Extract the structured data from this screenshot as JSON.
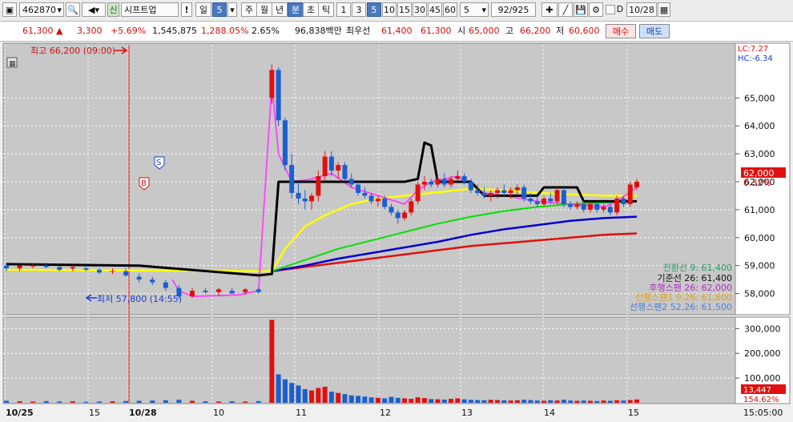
{
  "toolbar": {
    "code": "462870",
    "badge": "신",
    "name": "시프트업",
    "period_buttons": [
      "일",
      "5",
      "주",
      "월",
      "년",
      "분",
      "초",
      "틱"
    ],
    "interval_buttons": [
      "1",
      "3",
      "5",
      "10",
      "15",
      "30",
      "45",
      "60"
    ],
    "count": "5",
    "page": "92/925",
    "check_label": "D",
    "date": "10/28"
  },
  "quote": {
    "price": "61,300",
    "arrow": "▲",
    "change": "3,300",
    "change_pct": "+5.69%",
    "volume": "1,545,875",
    "volume_ratio": "1,288.05%",
    "turnover": "2.65%",
    "amount": "96,838백만",
    "best_label": "최우선",
    "best_ask": "61,400",
    "best_bid": "61,300",
    "open_label": "시",
    "open": "65,000",
    "high_label": "고",
    "high": "66,200",
    "low_label": "저",
    "low": "60,600",
    "buy": "매수",
    "sell": "매도"
  },
  "chart_data": {
    "type": "candlestick",
    "y_ticks": [
      "65,000",
      "64,000",
      "63,000",
      "62,000",
      "61,000",
      "60,000",
      "59,000",
      "58,000"
    ],
    "ylim": [
      57300,
      66900
    ],
    "volume_ticks": [
      "300,000",
      "200,000",
      "100,000"
    ],
    "volume_ylim": [
      0,
      340000
    ],
    "x_labels": [
      "10/25",
      "15",
      "10/28",
      "10",
      "11",
      "12",
      "13",
      "14",
      "15"
    ],
    "crosshair_time": "15:05:00",
    "lc": "LC:7.27",
    "hc": "HC:-6.34",
    "current_price": "62,000",
    "current_pct": "0.32%",
    "volume_current": "13,447",
    "volume_pct": "154.62%",
    "high_annotation": "최고 66,200 (09:00)",
    "low_annotation": "최저 57,800 (14:55)",
    "marker_s": "S",
    "marker_b": "B",
    "legend": [
      {
        "label": "전환선 9: 61,400",
        "color": "#2a9a6a"
      },
      {
        "label": "기준선 26: 61,400",
        "color": "#111111"
      },
      {
        "label": "후행스팬 26: 62,000",
        "color": "#b030c0"
      },
      {
        "label": "선행스팬1 9,26: 61,800",
        "color": "#e0a020"
      },
      {
        "label": "선행스팬2 52,26: 61,500",
        "color": "#4f7fd0"
      }
    ],
    "ma_colors": [
      "#ffff00",
      "#00e000",
      "#0000d0",
      "#e01010",
      "#ff40ff"
    ],
    "candles": [
      {
        "t": 0,
        "o": 59,
        "h": 59.1,
        "l": 58.8,
        "c": 58.9
      },
      {
        "t": 2,
        "o": 58.9,
        "h": 59,
        "l": 58.8,
        "c": 59
      },
      {
        "t": 4,
        "o": 59,
        "h": 59.1,
        "l": 58.9,
        "c": 59.0
      },
      {
        "t": 6,
        "o": 59,
        "h": 59.1,
        "l": 58.9,
        "c": 58.95
      },
      {
        "t": 8,
        "o": 58.95,
        "h": 59,
        "l": 58.8,
        "c": 58.85
      },
      {
        "t": 10,
        "o": 58.9,
        "h": 59,
        "l": 58.8,
        "c": 58.95
      },
      {
        "t": 12,
        "o": 58.9,
        "h": 59,
        "l": 58.8,
        "c": 58.85
      },
      {
        "t": 14,
        "o": 58.85,
        "h": 58.9,
        "l": 58.7,
        "c": 58.75
      },
      {
        "t": 16,
        "o": 58.8,
        "h": 58.9,
        "l": 58.7,
        "c": 58.8
      },
      {
        "t": 18,
        "o": 58.8,
        "h": 58.9,
        "l": 58.6,
        "c": 58.65
      },
      {
        "t": 20,
        "o": 58.6,
        "h": 58.7,
        "l": 58.4,
        "c": 58.5
      },
      {
        "t": 22,
        "o": 58.5,
        "h": 58.6,
        "l": 58.3,
        "c": 58.4
      },
      {
        "t": 24,
        "o": 58.4,
        "h": 58.5,
        "l": 58.1,
        "c": 58.2
      },
      {
        "t": 26,
        "o": 58.2,
        "h": 58.3,
        "l": 57.8,
        "c": 57.9
      },
      {
        "t": 28,
        "o": 57.9,
        "h": 58.2,
        "l": 57.85,
        "c": 58.1
      },
      {
        "t": 30,
        "o": 58.1,
        "h": 58.2,
        "l": 58.0,
        "c": 58.05
      },
      {
        "t": 32,
        "o": 58.05,
        "h": 58.2,
        "l": 57.9,
        "c": 58.15
      },
      {
        "t": 34,
        "o": 58.1,
        "h": 58.2,
        "l": 58.0,
        "c": 58.0
      },
      {
        "t": 36,
        "o": 58.05,
        "h": 58.2,
        "l": 57.95,
        "c": 58.15
      },
      {
        "t": 38,
        "o": 58.15,
        "h": 58.2,
        "l": 58.0,
        "c": 58.05
      },
      {
        "t": 40,
        "o": 65.0,
        "h": 66.2,
        "l": 64.8,
        "c": 66.0
      },
      {
        "t": 41,
        "o": 66.0,
        "h": 66.1,
        "l": 64.0,
        "c": 64.2
      },
      {
        "t": 42,
        "o": 64.2,
        "h": 64.3,
        "l": 62.4,
        "c": 62.6
      },
      {
        "t": 43,
        "o": 62.6,
        "h": 63.0,
        "l": 61.4,
        "c": 61.6
      },
      {
        "t": 44,
        "o": 61.6,
        "h": 62.0,
        "l": 61.2,
        "c": 61.4
      },
      {
        "t": 45,
        "o": 61.4,
        "h": 61.7,
        "l": 61.0,
        "c": 61.3
      },
      {
        "t": 46,
        "o": 61.3,
        "h": 61.6,
        "l": 61.0,
        "c": 61.5
      },
      {
        "t": 47,
        "o": 61.5,
        "h": 62.4,
        "l": 61.3,
        "c": 62.2
      },
      {
        "t": 48,
        "o": 62.2,
        "h": 63.1,
        "l": 62.0,
        "c": 62.9
      },
      {
        "t": 49,
        "o": 62.9,
        "h": 63.1,
        "l": 62.2,
        "c": 62.4
      },
      {
        "t": 50,
        "o": 62.4,
        "h": 62.7,
        "l": 62.1,
        "c": 62.6
      },
      {
        "t": 51,
        "o": 62.6,
        "h": 62.7,
        "l": 62.0,
        "c": 62.1
      },
      {
        "t": 52,
        "o": 62.1,
        "h": 62.3,
        "l": 61.8,
        "c": 61.9
      },
      {
        "t": 53,
        "o": 61.9,
        "h": 62.0,
        "l": 61.5,
        "c": 61.6
      },
      {
        "t": 54,
        "o": 61.6,
        "h": 61.8,
        "l": 61.4,
        "c": 61.5
      },
      {
        "t": 55,
        "o": 61.5,
        "h": 61.6,
        "l": 61.2,
        "c": 61.3
      },
      {
        "t": 56,
        "o": 61.3,
        "h": 61.5,
        "l": 61.1,
        "c": 61.4
      },
      {
        "t": 57,
        "o": 61.4,
        "h": 61.5,
        "l": 61.0,
        "c": 61.1
      },
      {
        "t": 58,
        "o": 61.1,
        "h": 61.2,
        "l": 60.8,
        "c": 60.9
      },
      {
        "t": 59,
        "o": 60.9,
        "h": 61.0,
        "l": 60.5,
        "c": 60.7
      },
      {
        "t": 60,
        "o": 60.7,
        "h": 61.0,
        "l": 60.6,
        "c": 60.9
      },
      {
        "t": 61,
        "o": 60.9,
        "h": 61.4,
        "l": 60.8,
        "c": 61.3
      },
      {
        "t": 62,
        "o": 61.3,
        "h": 62.0,
        "l": 61.2,
        "c": 61.9
      },
      {
        "t": 63,
        "o": 61.9,
        "h": 62.2,
        "l": 61.7,
        "c": 62.0
      },
      {
        "t": 64,
        "o": 62.0,
        "h": 62.1,
        "l": 61.8,
        "c": 61.9
      },
      {
        "t": 65,
        "o": 61.9,
        "h": 62.2,
        "l": 61.8,
        "c": 62.1
      },
      {
        "t": 66,
        "o": 62.1,
        "h": 62.3,
        "l": 61.8,
        "c": 61.9
      },
      {
        "t": 67,
        "o": 61.9,
        "h": 62.2,
        "l": 61.8,
        "c": 62.1
      },
      {
        "t": 68,
        "o": 62.1,
        "h": 62.4,
        "l": 62.0,
        "c": 62.2
      },
      {
        "t": 69,
        "o": 62.2,
        "h": 62.3,
        "l": 61.9,
        "c": 62.0
      },
      {
        "t": 70,
        "o": 62.0,
        "h": 62.1,
        "l": 61.6,
        "c": 61.7
      },
      {
        "t": 71,
        "o": 61.7,
        "h": 61.9,
        "l": 61.5,
        "c": 61.6
      },
      {
        "t": 72,
        "o": 61.6,
        "h": 61.8,
        "l": 61.4,
        "c": 61.5
      },
      {
        "t": 73,
        "o": 61.5,
        "h": 61.7,
        "l": 61.3,
        "c": 61.6
      },
      {
        "t": 74,
        "o": 61.6,
        "h": 61.8,
        "l": 61.4,
        "c": 61.7
      },
      {
        "t": 75,
        "o": 61.7,
        "h": 61.9,
        "l": 61.5,
        "c": 61.6
      },
      {
        "t": 76,
        "o": 61.6,
        "h": 61.8,
        "l": 61.4,
        "c": 61.7
      },
      {
        "t": 77,
        "o": 61.7,
        "h": 61.9,
        "l": 61.5,
        "c": 61.8
      },
      {
        "t": 78,
        "o": 61.8,
        "h": 61.9,
        "l": 61.3,
        "c": 61.4
      },
      {
        "t": 79,
        "o": 61.4,
        "h": 61.6,
        "l": 61.2,
        "c": 61.3
      },
      {
        "t": 80,
        "o": 61.3,
        "h": 61.5,
        "l": 61.1,
        "c": 61.2
      },
      {
        "t": 81,
        "o": 61.2,
        "h": 61.5,
        "l": 61.1,
        "c": 61.4
      },
      {
        "t": 82,
        "o": 61.4,
        "h": 61.6,
        "l": 61.2,
        "c": 61.3
      },
      {
        "t": 83,
        "o": 61.3,
        "h": 61.8,
        "l": 61.2,
        "c": 61.7
      },
      {
        "t": 84,
        "o": 61.7,
        "h": 61.8,
        "l": 61.1,
        "c": 61.2
      },
      {
        "t": 85,
        "o": 61.2,
        "h": 61.3,
        "l": 61.0,
        "c": 61.1
      },
      {
        "t": 86,
        "o": 61.1,
        "h": 61.3,
        "l": 61.0,
        "c": 61.2
      },
      {
        "t": 87,
        "o": 61.2,
        "h": 61.3,
        "l": 60.9,
        "c": 61.0
      },
      {
        "t": 88,
        "o": 61.0,
        "h": 61.3,
        "l": 60.9,
        "c": 61.2
      },
      {
        "t": 89,
        "o": 61.2,
        "h": 61.3,
        "l": 60.9,
        "c": 61.0
      },
      {
        "t": 90,
        "o": 61.0,
        "h": 61.2,
        "l": 60.9,
        "c": 61.1
      },
      {
        "t": 91,
        "o": 61.1,
        "h": 61.2,
        "l": 60.8,
        "c": 60.9
      },
      {
        "t": 92,
        "o": 60.9,
        "h": 61.5,
        "l": 60.8,
        "c": 61.4
      },
      {
        "t": 93,
        "o": 61.4,
        "h": 61.5,
        "l": 61.1,
        "c": 61.2
      },
      {
        "t": 94,
        "o": 61.2,
        "h": 62.0,
        "l": 61.1,
        "c": 61.9
      },
      {
        "t": 95,
        "o": 61.8,
        "h": 62.1,
        "l": 61.7,
        "c": 62.0
      }
    ],
    "volumes": [
      8000,
      6000,
      5000,
      7000,
      5000,
      6000,
      4000,
      5000,
      6000,
      7000,
      8000,
      9000,
      10000,
      12000,
      8000,
      6000,
      5000,
      6000,
      5000,
      7000,
      335000,
      115000,
      95000,
      80000,
      70000,
      55000,
      50000,
      60000,
      65000,
      45000,
      40000,
      35000,
      30000,
      28000,
      25000,
      22000,
      20000,
      18000,
      24000,
      20000,
      18000,
      16000,
      22000,
      19000,
      15000,
      14000,
      13000,
      16000,
      18000,
      14000,
      12000,
      11000,
      10000,
      12000,
      11000,
      10000,
      9000,
      10000,
      12000,
      11000,
      9000,
      8000,
      10000,
      9000,
      12000,
      9000,
      8000,
      9000,
      8000,
      7000,
      9000,
      8000,
      10000,
      9000,
      11000,
      13447
    ],
    "kijun": [
      [
        0,
        59.05
      ],
      [
        20,
        59.0
      ],
      [
        38,
        58.65
      ],
      [
        40,
        58.7
      ],
      [
        41,
        62.0
      ],
      [
        60,
        62.0
      ],
      [
        62,
        62.1
      ],
      [
        63,
        63.4
      ],
      [
        64,
        63.3
      ],
      [
        65,
        62.0
      ],
      [
        70,
        62.0
      ],
      [
        72,
        61.5
      ],
      [
        80,
        61.5
      ],
      [
        81,
        61.8
      ],
      [
        86,
        61.8
      ],
      [
        87,
        61.3
      ],
      [
        95,
        61.3
      ]
    ],
    "span1": [
      [
        0,
        58.85
      ],
      [
        40,
        58.8
      ],
      [
        42,
        59.6
      ],
      [
        45,
        60.4
      ],
      [
        48,
        60.8
      ],
      [
        52,
        61.2
      ],
      [
        56,
        61.4
      ],
      [
        62,
        61.55
      ],
      [
        66,
        61.65
      ],
      [
        70,
        61.75
      ],
      [
        75,
        61.7
      ],
      [
        80,
        61.6
      ],
      [
        85,
        61.55
      ],
      [
        90,
        61.5
      ],
      [
        95,
        61.5
      ]
    ],
    "green": [
      [
        40,
        58.8
      ],
      [
        45,
        59.2
      ],
      [
        50,
        59.6
      ],
      [
        55,
        59.9
      ],
      [
        60,
        60.2
      ],
      [
        65,
        60.5
      ],
      [
        70,
        60.75
      ],
      [
        75,
        60.95
      ],
      [
        80,
        61.1
      ],
      [
        85,
        61.2
      ],
      [
        90,
        61.25
      ],
      [
        95,
        61.3
      ]
    ],
    "blue": [
      [
        40,
        58.8
      ],
      [
        45,
        59.0
      ],
      [
        50,
        59.25
      ],
      [
        55,
        59.45
      ],
      [
        60,
        59.65
      ],
      [
        65,
        59.85
      ],
      [
        70,
        60.1
      ],
      [
        75,
        60.3
      ],
      [
        80,
        60.45
      ],
      [
        85,
        60.6
      ],
      [
        90,
        60.7
      ],
      [
        95,
        60.75
      ]
    ],
    "redline": [
      [
        40,
        58.8
      ],
      [
        45,
        58.95
      ],
      [
        50,
        59.1
      ],
      [
        55,
        59.25
      ],
      [
        60,
        59.4
      ],
      [
        65,
        59.55
      ],
      [
        70,
        59.7
      ],
      [
        75,
        59.8
      ],
      [
        80,
        59.9
      ],
      [
        85,
        60.0
      ],
      [
        90,
        60.1
      ],
      [
        95,
        60.15
      ]
    ],
    "chikou": [
      [
        25,
        58.5
      ],
      [
        26,
        58.1
      ],
      [
        28,
        57.9
      ],
      [
        35,
        57.95
      ],
      [
        38,
        58.1
      ],
      [
        40,
        65.5
      ],
      [
        41,
        63.0
      ],
      [
        43,
        62.0
      ],
      [
        46,
        62.1
      ],
      [
        49,
        62.3
      ],
      [
        52,
        61.8
      ],
      [
        56,
        61.5
      ],
      [
        60,
        61.2
      ],
      [
        62,
        61.7
      ],
      [
        64,
        62.0
      ],
      [
        66,
        62.1
      ],
      [
        68,
        62.2
      ],
      [
        70,
        61.9
      ],
      [
        72,
        61.6
      ],
      [
        75,
        61.5
      ],
      [
        80,
        61.3
      ],
      [
        85,
        61.2
      ],
      [
        90,
        61.1
      ],
      [
        92,
        61.3
      ],
      [
        95,
        61.8
      ]
    ]
  }
}
